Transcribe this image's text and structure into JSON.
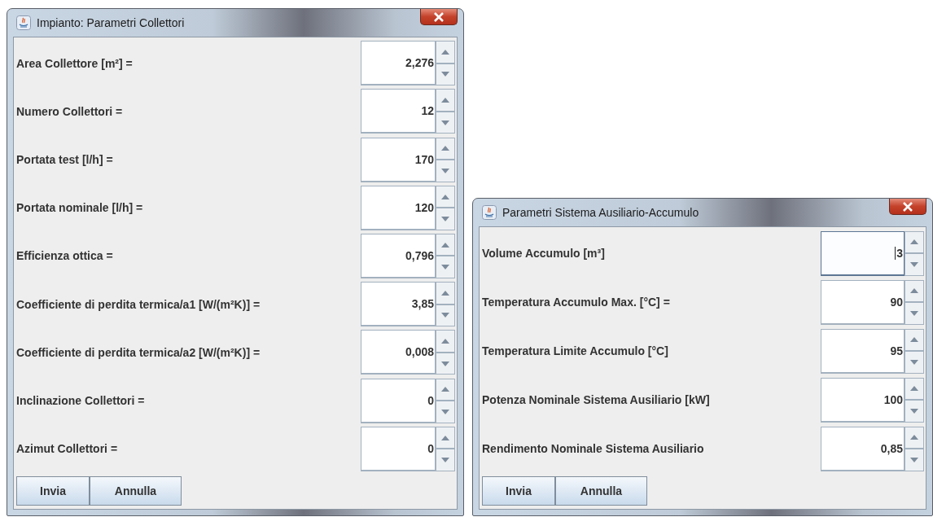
{
  "windows": [
    {
      "title": "Impianto: Parametri Collettori",
      "fields": [
        {
          "label": "Area Collettore [m²] =",
          "value": "2,276",
          "focused": false
        },
        {
          "label": "Numero Collettori =",
          "value": "12",
          "focused": false
        },
        {
          "label": "Portata test [l/h] =",
          "value": "170",
          "focused": false
        },
        {
          "label": "Portata nominale [l/h] =",
          "value": "120",
          "focused": false
        },
        {
          "label": "Efficienza ottica =",
          "value": "0,796",
          "focused": false
        },
        {
          "label": "Coefficiente di perdita termica/a1 [W/(m²K)] =",
          "value": "3,85",
          "focused": false
        },
        {
          "label": "Coefficiente di perdita termica/a2 [W/(m²K)] =",
          "value": "0,008",
          "focused": false
        },
        {
          "label": "Inclinazione Collettori =",
          "value": "0",
          "focused": false
        },
        {
          "label": "Azimut Collettori =",
          "value": "0",
          "focused": false
        }
      ],
      "buttons": [
        "Invia",
        "Annulla"
      ]
    },
    {
      "title": "Parametri Sistema Ausiliario-Accumulo",
      "fields": [
        {
          "label": "Volume Accumulo [m³]",
          "value": "3",
          "focused": true
        },
        {
          "label": "Temperatura Accumulo Max. [°C] =",
          "value": "90",
          "focused": false
        },
        {
          "label": "Temperatura Limite Accumulo [°C]",
          "value": "95",
          "focused": false
        },
        {
          "label": "Potenza Nominale Sistema Ausiliario [kW]",
          "value": "100",
          "focused": false
        },
        {
          "label": "Rendimento Nominale Sistema Ausiliario",
          "value": "0,85",
          "focused": false
        }
      ],
      "buttons": [
        "Invia",
        "Annulla"
      ]
    }
  ]
}
